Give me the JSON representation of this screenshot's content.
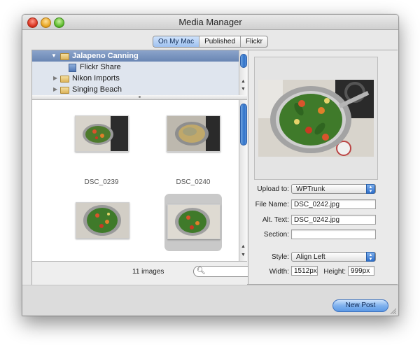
{
  "window": {
    "title": "Media Manager"
  },
  "tabs": [
    {
      "label": "On My Mac",
      "active": true
    },
    {
      "label": "Published",
      "active": false
    },
    {
      "label": "Flickr",
      "active": false
    }
  ],
  "sources": [
    {
      "label": "Jalapeno Canning",
      "icon": "folder-icon",
      "expanded": true,
      "selected": true
    },
    {
      "label": "Flickr Share",
      "icon": "document-icon",
      "expanded": false,
      "selected": false
    },
    {
      "label": "Nikon Imports",
      "icon": "folder-icon",
      "expanded": false,
      "selected": false
    },
    {
      "label": "Singing Beach",
      "icon": "folder-icon",
      "expanded": false,
      "selected": false
    }
  ],
  "images": [
    {
      "caption": "DSC_0239"
    },
    {
      "caption": "DSC_0240"
    },
    {
      "caption": ""
    },
    {
      "caption": ""
    }
  ],
  "status": {
    "count": "11 images",
    "search_placeholder": ""
  },
  "inspector": {
    "upload_to_label": "Upload to:",
    "upload_to_value": "WPTrunk",
    "file_name_label": "File Name:",
    "file_name_value": "DSC_0242.jpg",
    "alt_text_label": "Alt. Text:",
    "alt_text_value": "DSC_0242.jpg",
    "section_label": "Section:",
    "section_value": "",
    "style_label": "Style:",
    "style_value": "Align Left",
    "width_label": "Width:",
    "width_value": "1512px",
    "height_label": "Height:",
    "height_value": "999px"
  },
  "actions": {
    "new_post": "New Post"
  },
  "colors": {
    "selection": "#7792c0",
    "accent": "#2f72c9",
    "pot_green": "#3f7a2a"
  }
}
